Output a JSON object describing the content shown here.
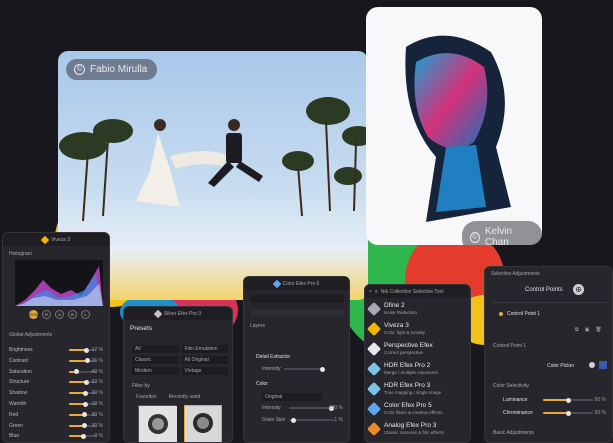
{
  "photos": {
    "main_credit": "Fabio Mirulla",
    "portrait_credit": "Kelvin Chan"
  },
  "viveza": {
    "title": "Viveza 3",
    "histogram_label": "Histogram",
    "channels": [
      "RGB",
      "R",
      "G",
      "B",
      "L"
    ],
    "section": "Global Adjustments",
    "sliders": [
      {
        "label": "Brightness",
        "value": "17 %",
        "level": 0.62
      },
      {
        "label": "Contrast",
        "value": "26 %",
        "level": 0.66
      },
      {
        "label": "Saturation",
        "value": "-40 %",
        "level": 0.25
      },
      {
        "label": "Structure",
        "value": "23 %",
        "level": 0.63
      },
      {
        "label": "Shadow",
        "value": "20 %",
        "level": 0.6
      },
      {
        "label": "Warmth",
        "value": "18 %",
        "level": 0.58
      },
      {
        "label": "Red",
        "value": "30 %",
        "level": 0.56
      },
      {
        "label": "Green",
        "value": "30 %",
        "level": 0.56
      },
      {
        "label": "Blue",
        "value": "0 %",
        "level": 0.5
      }
    ]
  },
  "silver": {
    "title": "Silver Efex Pro 3",
    "presets_label": "Presets",
    "filter_by": "Filter by",
    "preset_tabs": [
      "All",
      "Classic",
      "Modern",
      "Film Emulation",
      "All Original",
      "Vintage"
    ],
    "favorites": "Favorites",
    "recently_used": "Recently used"
  },
  "color_efex": {
    "title": "Color Efex Pro 6",
    "layers": "Layers",
    "filter_name": "Detail Extractor",
    "section2": "Color",
    "rows": [
      {
        "label": "Intensity",
        "value": "100 %"
      },
      {
        "label": "Original",
        "value": ""
      },
      {
        "label": "Intensity",
        "value": "100 %"
      },
      {
        "label": "Grain Size",
        "value": "1 %"
      }
    ]
  },
  "nik": {
    "title": "Nik Collection Selective Tool",
    "items": [
      {
        "name": "Dfine 2",
        "desc": "Noise Reduction",
        "color": "#a9a9b2"
      },
      {
        "name": "Viveza 3",
        "desc": "Color, light & tonality",
        "color": "#f2b400"
      },
      {
        "name": "Perspective Efex",
        "desc": "Correct perspective",
        "color": "#e8e8ec"
      },
      {
        "name": "HDR Efex Pro 2",
        "desc": "Merge / multiple exposures",
        "color": "#7ec3e6"
      },
      {
        "name": "HDR Efex Pro 3",
        "desc": "Tone mapping / single image",
        "color": "#7ec3e6"
      },
      {
        "name": "Color Efex Pro 5",
        "desc": "Color filters & creative effects",
        "color": "#5aa8f0"
      },
      {
        "name": "Analog Efex Pro 3",
        "desc": "Classic cameras & film effects",
        "color": "#ef8a2a"
      }
    ]
  },
  "selective": {
    "title": "Selective Adjustments",
    "control_points": "Control Points",
    "control_point_1": "Control Point 1",
    "color_picker": "Color Picker",
    "color_selectivity": "Color Selectivity",
    "luminance": {
      "label": "Luminance",
      "value": "50 %"
    },
    "chrominance": {
      "label": "Chrominance",
      "value": "50 %"
    },
    "basic": "Basic Adjustments",
    "control_point_label": "Control Point 1"
  }
}
